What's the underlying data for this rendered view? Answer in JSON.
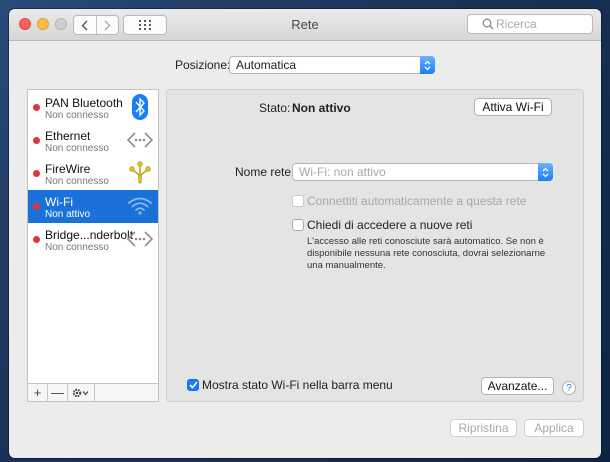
{
  "window": {
    "title": "Rete"
  },
  "search": {
    "placeholder": "Ricerca"
  },
  "location": {
    "label": "Posizione:",
    "value": "Automatica"
  },
  "services": [
    {
      "name": "PAN Bluetooth",
      "status": "Non connesso",
      "icon": "bluetooth-icon",
      "selected": false
    },
    {
      "name": "Ethernet",
      "status": "Non connesso",
      "icon": "ethernet-icon",
      "selected": false
    },
    {
      "name": "FireWire",
      "status": "Non connesso",
      "icon": "firewire-icon",
      "selected": false
    },
    {
      "name": "Wi-Fi",
      "status": "Non attivo",
      "icon": "wifi-icon",
      "selected": true
    },
    {
      "name": "Bridge...nderbolt",
      "status": "Non connesso",
      "icon": "thunderbolt-bridge-icon",
      "selected": false
    }
  ],
  "sidebar_buttons": {
    "add": "+",
    "remove": "—"
  },
  "detail": {
    "status_label": "Stato:",
    "status_value": "Non attivo",
    "activate_button": "Attiva Wi-Fi",
    "network_label": "Nome rete:",
    "network_value": "Wi-Fi: non attivo",
    "auto_join": {
      "label": "Connettiti automaticamente a questa rete",
      "checked": false,
      "enabled": false
    },
    "ask_join": {
      "label": "Chiedi di accedere a nuove reti",
      "checked": false,
      "enabled": true
    },
    "ask_join_help": "L'accesso alle reti conosciute sarà automatico. Se non è disponibile nessuna rete conosciuta, dovrai selezionarne una manualmente.",
    "menu_bar_status": {
      "label": "Mostra stato Wi-Fi nella barra menu",
      "checked": true
    },
    "advanced_button": "Avanzate...",
    "help_button": "?"
  },
  "footer": {
    "revert_button": "Ripristina",
    "apply_button": "Applica"
  },
  "colors": {
    "selection": "#1a72d8",
    "status_dot": "#e0353c",
    "accent": "#1d7cf2"
  }
}
